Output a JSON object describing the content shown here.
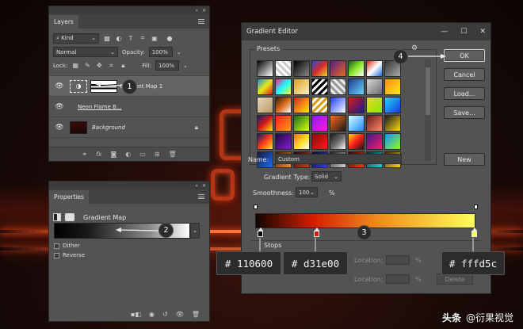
{
  "layers_panel": {
    "tab": "Layers",
    "filter_kind": "Kind",
    "blend_mode": "Normal",
    "opacity_label": "Opacity:",
    "opacity_value": "100%",
    "lock_label": "Lock:",
    "fill_label": "Fill:",
    "fill_value": "100%",
    "layers": [
      {
        "name": "Gradient Map 1",
        "selected": true,
        "icon": "adjustment-thumb"
      },
      {
        "name": "Neon Flame B...",
        "selected": false,
        "icon": "smart-object-thumb"
      },
      {
        "name": "Background",
        "selected": false,
        "icon": "background-thumb",
        "locked": true
      }
    ]
  },
  "properties_panel": {
    "tab": "Properties",
    "title": "Gradient Map",
    "dither_label": "Dither",
    "reverse_label": "Reverse"
  },
  "gradient_editor": {
    "title": "Gradient Editor",
    "presets_label": "Presets",
    "ok_label": "OK",
    "cancel_label": "Cancel",
    "load_label": "Load...",
    "save_label": "Save...",
    "name_label": "Name:",
    "name_value": "Custom",
    "new_label": "New",
    "gradient_type_label": "Gradient Type:",
    "gradient_type_value": "Solid",
    "smoothness_label": "Smoothness:",
    "smoothness_value": "100",
    "smoothness_unit": "%",
    "stops_label": "Stops",
    "location_label": "Location:",
    "percent": "%",
    "delete_label": "Delete",
    "gradient_colors": [
      "#110600",
      "#d31e00",
      "#fffd5c"
    ]
  },
  "callouts": {
    "step1": "1",
    "step2": "2",
    "step3": "3",
    "step4": "4",
    "color1": "# 110600",
    "color2": "# d31e00",
    "color3": "# fffd5c"
  },
  "watermark": {
    "brand": "头条",
    "handle": "@衍果视觉"
  }
}
